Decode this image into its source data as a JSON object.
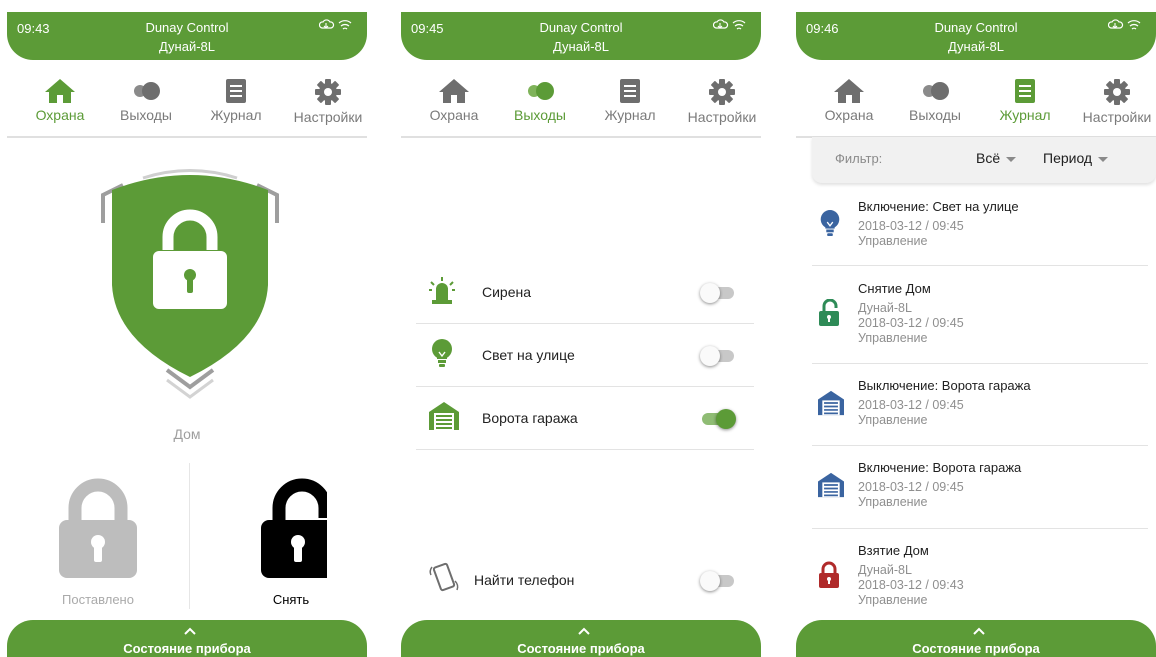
{
  "status_bar": {
    "app_name": "Dunay Control",
    "device_name": "Дунай-8L"
  },
  "tabs": [
    {
      "label": "Охрана"
    },
    {
      "label": "Выходы"
    },
    {
      "label": "Журнал"
    },
    {
      "label": "Настройки"
    }
  ],
  "bottom_bar": {
    "label": "Состояние прибора"
  },
  "colors": {
    "accent": "#5c9b37",
    "blue_icon": "#3a64a0",
    "red_icon": "#b02a2a",
    "teal_icon": "#2e8b57"
  },
  "screens": [
    {
      "time": "09:43",
      "active_tab": "Охрана",
      "zone_name": "Дом",
      "arm_state_label": "Поставлено",
      "disarm_button_label": "Снять"
    },
    {
      "time": "09:45",
      "active_tab": "Выходы",
      "outputs": [
        {
          "label": "Сирена",
          "icon": "siren-icon",
          "on": false
        },
        {
          "label": "Свет на улице",
          "icon": "bulb-icon",
          "on": false
        },
        {
          "label": "Ворота гаража",
          "icon": "garage-icon",
          "on": true
        }
      ],
      "find_phone": {
        "label": "Найти телефон",
        "on": false
      }
    },
    {
      "time": "09:46",
      "active_tab": "Журнал",
      "filter": {
        "label": "Фильтр:",
        "type_value": "Всё",
        "period_value": "Период"
      },
      "log": [
        {
          "title": "Включение: Свет на улице",
          "icon": "bulb-icon",
          "lines": [
            "2018-03-12 / 09:45",
            "Управление"
          ]
        },
        {
          "title": "Снятие Дом",
          "icon": "unlock-icon",
          "lines": [
            "Дунай-8L",
            "2018-03-12 / 09:45",
            "Управление"
          ]
        },
        {
          "title": "Выключение: Ворота гаража",
          "icon": "garage-icon",
          "lines": [
            "2018-03-12 / 09:45",
            "Управление"
          ]
        },
        {
          "title": "Включение: Ворота гаража",
          "icon": "garage-icon",
          "lines": [
            "2018-03-12 / 09:45",
            "Управление"
          ]
        },
        {
          "title": "Взятие Дом",
          "icon": "lock-icon",
          "lines": [
            "Дунай-8L",
            "2018-03-12 / 09:43",
            "Управление"
          ]
        }
      ]
    }
  ]
}
